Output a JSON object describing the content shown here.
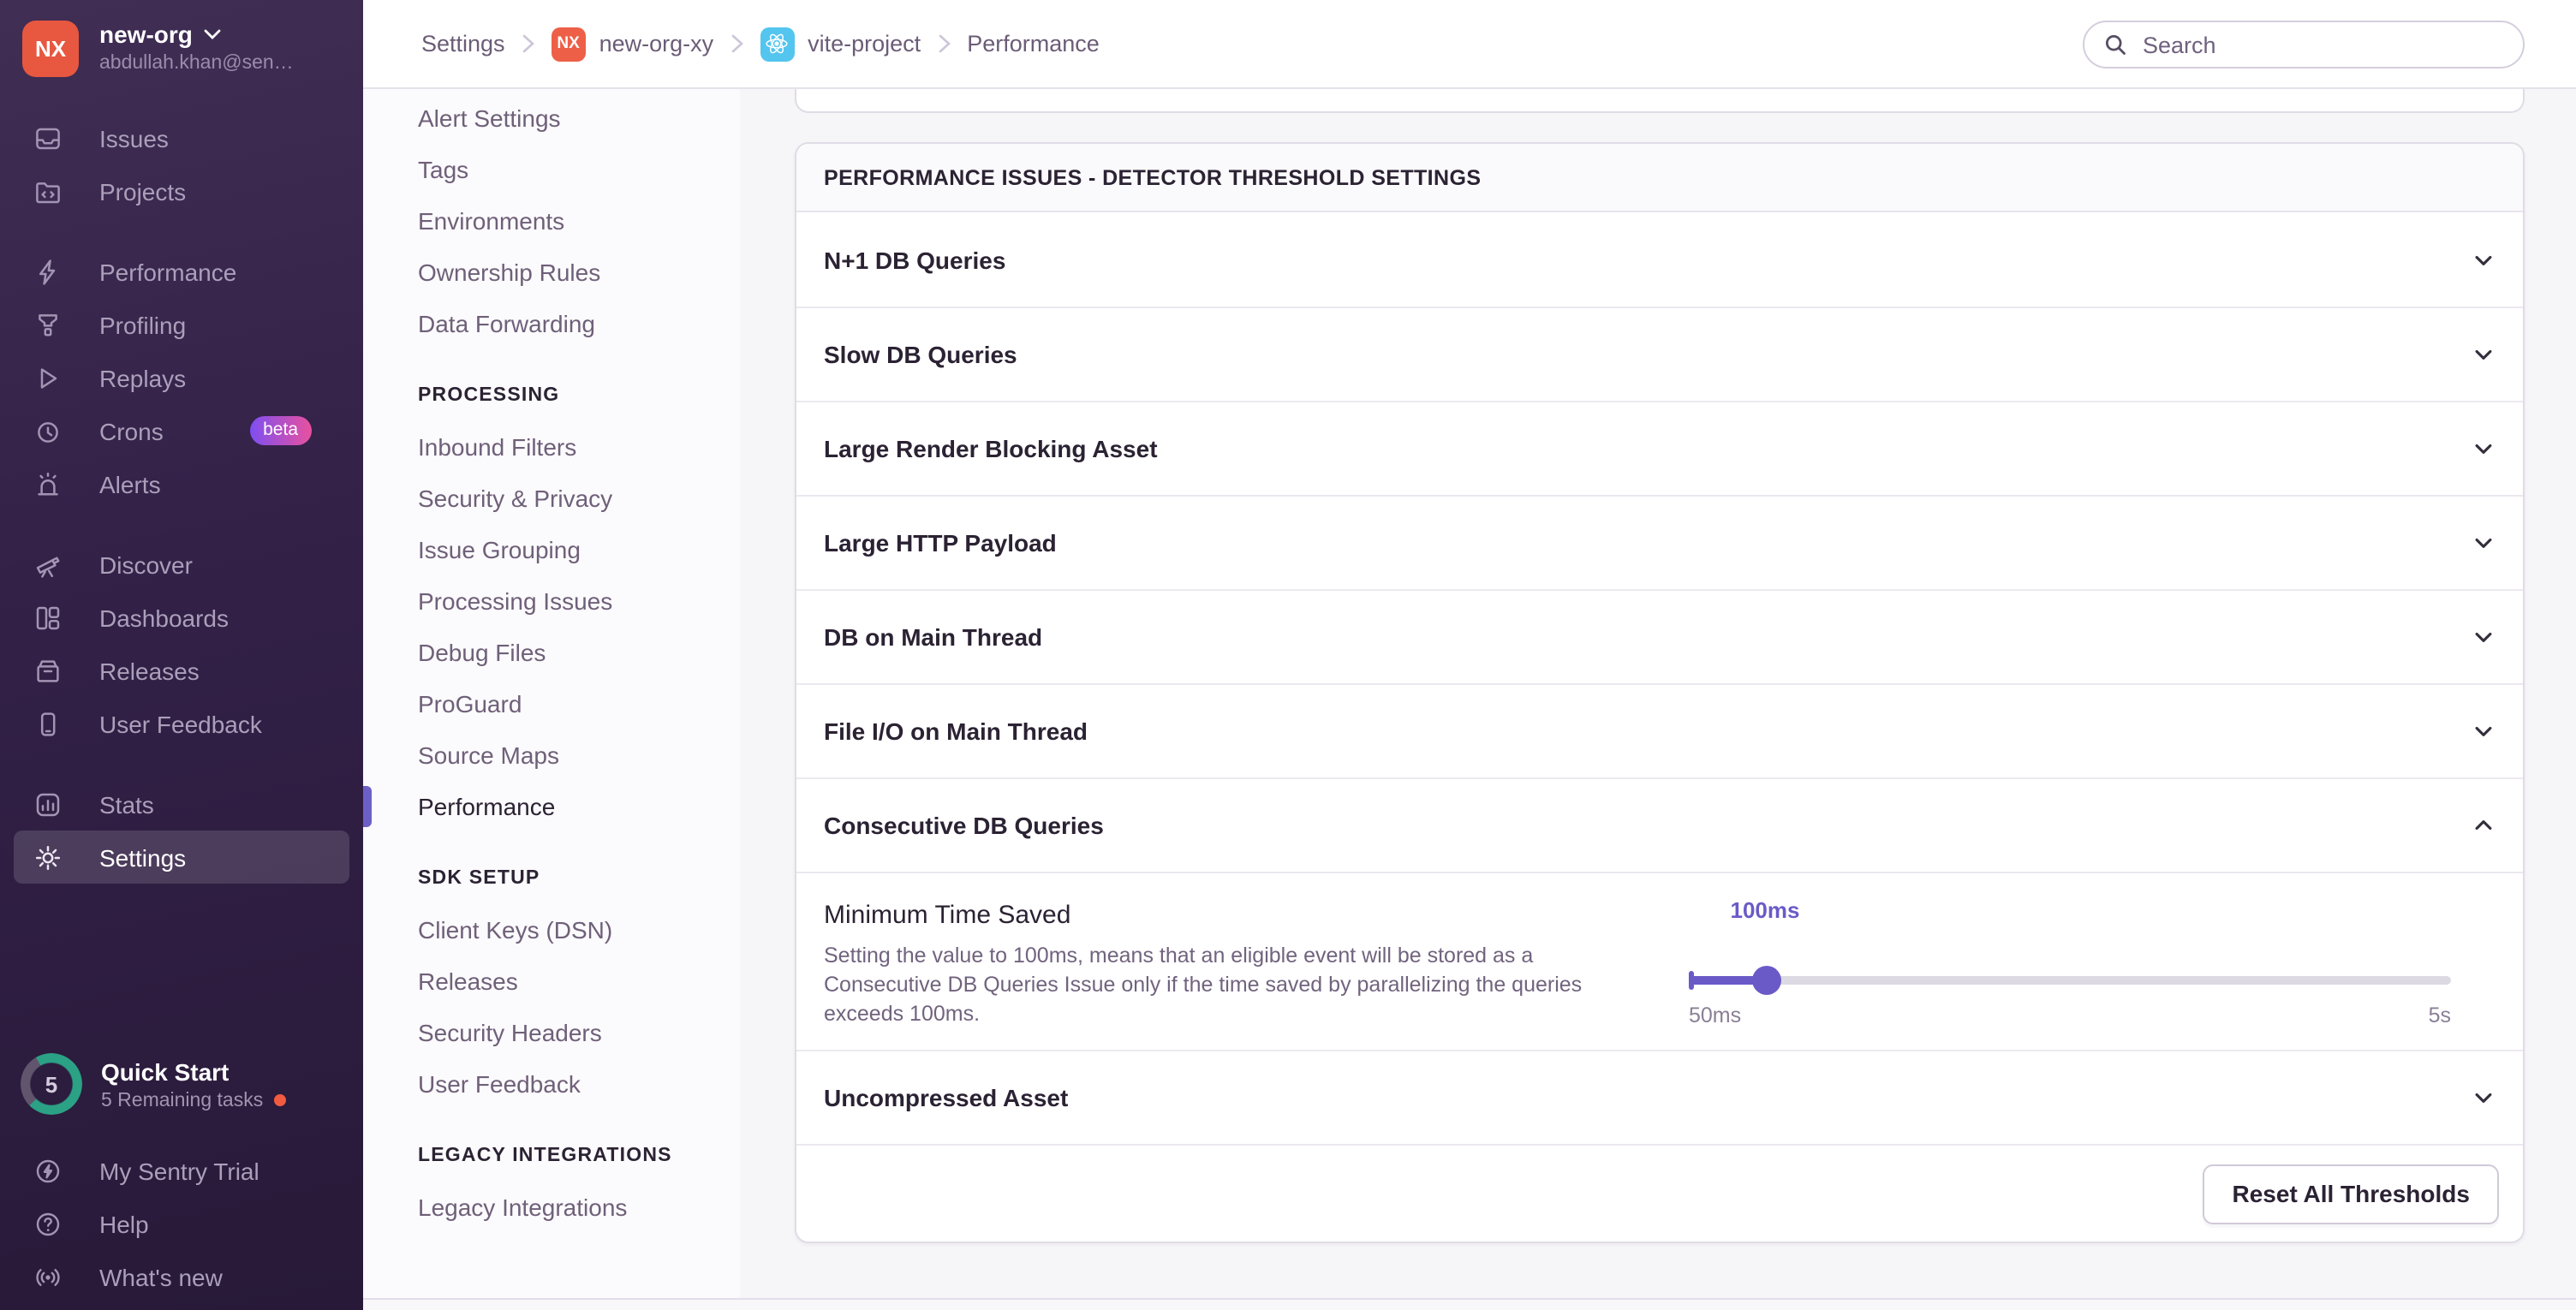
{
  "org": {
    "initials": "NX",
    "name": "new-org",
    "email": "abdullah.khan@sen…"
  },
  "sidebar": {
    "items": [
      {
        "label": "Issues"
      },
      {
        "label": "Projects"
      },
      {
        "label": "Performance"
      },
      {
        "label": "Profiling"
      },
      {
        "label": "Replays"
      },
      {
        "label": "Crons",
        "badge": "beta"
      },
      {
        "label": "Alerts"
      },
      {
        "label": "Discover"
      },
      {
        "label": "Dashboards"
      },
      {
        "label": "Releases"
      },
      {
        "label": "User Feedback"
      },
      {
        "label": "Stats"
      },
      {
        "label": "Settings"
      }
    ]
  },
  "quickstart": {
    "title": "Quick Start",
    "subtitle": "5 Remaining tasks",
    "count": "5"
  },
  "sidebar_footer": {
    "items": [
      {
        "label": "My Sentry Trial"
      },
      {
        "label": "Help"
      },
      {
        "label": "What's new"
      }
    ]
  },
  "breadcrumb": {
    "org_badge": "NX",
    "items": [
      "Settings",
      "new-org-xy",
      "vite-project",
      "Performance"
    ]
  },
  "search": {
    "placeholder": "Search"
  },
  "settings_nav": {
    "items_top": [
      "Alert Settings",
      "Tags",
      "Environments",
      "Ownership Rules",
      "Data Forwarding"
    ],
    "sections": [
      {
        "header": "PROCESSING",
        "items": [
          "Inbound Filters",
          "Security & Privacy",
          "Issue Grouping",
          "Processing Issues",
          "Debug Files",
          "ProGuard",
          "Source Maps",
          "Performance"
        ]
      },
      {
        "header": "SDK SETUP",
        "items": [
          "Client Keys (DSN)",
          "Releases",
          "Security Headers",
          "User Feedback"
        ]
      },
      {
        "header": "LEGACY INTEGRATIONS",
        "items": [
          "Legacy Integrations"
        ]
      }
    ],
    "active": "Performance"
  },
  "panel": {
    "header": "PERFORMANCE ISSUES - DETECTOR THRESHOLD SETTINGS",
    "rows": [
      {
        "label": "N+1 DB Queries",
        "state": "collapsed"
      },
      {
        "label": "Slow DB Queries",
        "state": "collapsed"
      },
      {
        "label": "Large Render Blocking Asset",
        "state": "collapsed"
      },
      {
        "label": "Large HTTP Payload",
        "state": "collapsed"
      },
      {
        "label": "DB on Main Thread",
        "state": "collapsed"
      },
      {
        "label": "File I/O on Main Thread",
        "state": "collapsed"
      },
      {
        "label": "Consecutive DB Queries",
        "state": "expanded"
      },
      {
        "label": "Uncompressed Asset",
        "state": "collapsed"
      }
    ],
    "expanded": {
      "title": "Minimum Time Saved",
      "description": "Setting the value to 100ms, means that an eligible event will be stored as a Consecutive DB Queries Issue only if the time saved by parallelizing the queries exceeds 100ms.",
      "slider": {
        "value_label": "100ms",
        "min_label": "50ms",
        "max_label": "5s",
        "percent": 10
      }
    },
    "footer_button": "Reset All Thresholds"
  },
  "colors": {
    "accent": "#6C5FC7",
    "org_avatar": "#E8573F",
    "beta_gradient_start": "#7E4FF1",
    "beta_gradient_end": "#E8519E",
    "project_icon_bg": "#53C5EF",
    "progress_ring": "#2BA185",
    "notification_dot": "#F25B40"
  }
}
